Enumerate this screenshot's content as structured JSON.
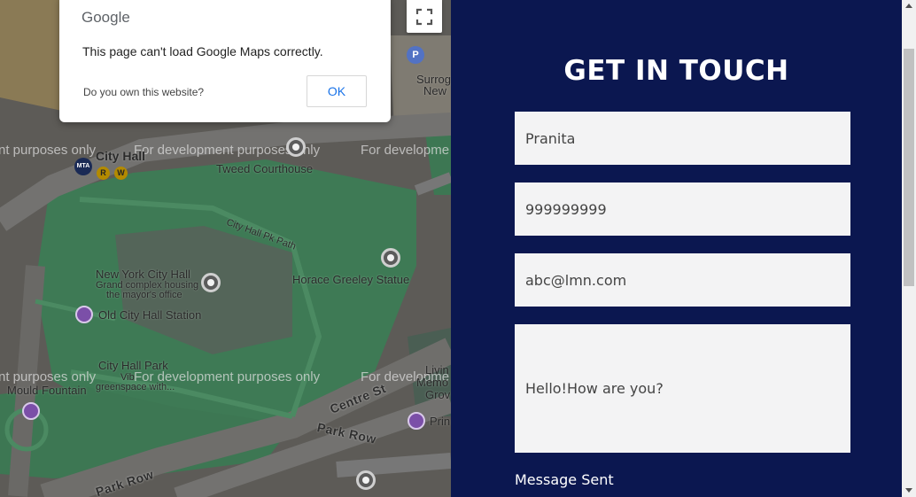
{
  "map": {
    "watermark": "For development purposes only",
    "watermark_cut_left": "nt purposes only",
    "watermark_cut_right": "For developme",
    "labels": {
      "city_hall": "City Hall",
      "tweed": "Tweed Courthouse",
      "city_hall_pk_path": "City Hall Pk Path",
      "nyc_hall": "New York City Hall",
      "nyc_hall_desc1": "Grand complex housing",
      "nyc_hall_desc2": "the mayor's office",
      "horace": "Horace Greeley Statue",
      "old_station": "Old City Hall Station",
      "city_hall_park": "City Hall Park",
      "city_hall_park_desc1": "Vib",
      "city_hall_park_desc2": "greenspace with...",
      "mould": "Mould Fountain",
      "centre_st": "Centre St",
      "park_row_1": "Park Row",
      "park_row_2": "Park Row",
      "surrog": "Surrog",
      "new": "New",
      "livin": "Livin",
      "memo": "Memo",
      "grov": "Grov",
      "prin": "Prin",
      "mta": "MTA",
      "line_r": "R",
      "line_w": "W",
      "parking": "P"
    }
  },
  "dialog": {
    "logo": "Google",
    "message": "This page can't load Google Maps correctly.",
    "own_site_link": "Do you own this website?",
    "ok_label": "OK"
  },
  "contact": {
    "title": "GET IN TOUCH",
    "name_value": "Pranita",
    "phone_value": "999999999",
    "email_value": "abc@lmn.com",
    "message_value": "Hello!How are you?",
    "status": "Message Sent"
  },
  "colors": {
    "panel_bg": "#0b1750",
    "field_bg": "#f3f3f4",
    "map_green": "#3e7a55",
    "ok_blue": "#1a73e8"
  }
}
